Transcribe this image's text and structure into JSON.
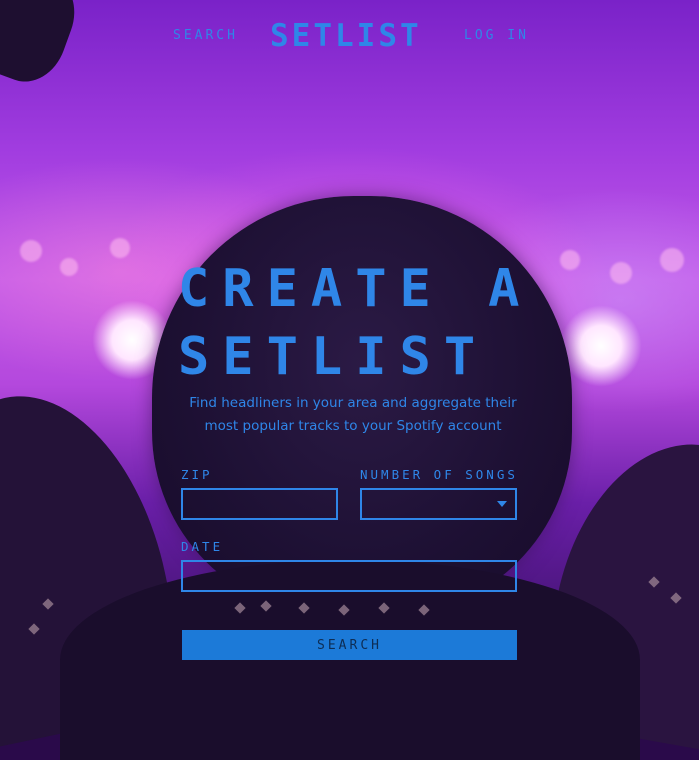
{
  "header": {
    "search_link": "SEARCH",
    "logo": "SETLIST",
    "login_link": "LOG IN"
  },
  "hero": {
    "title_line1": "CREATE A",
    "title_line2": "SETLIST",
    "subtitle": "Find headliners in your area and aggregate their most popular tracks to your Spotify account"
  },
  "form": {
    "zip_label": "ZIP",
    "zip_value": "",
    "songs_label": "NUMBER OF SONGS",
    "songs_selected": "",
    "date_label": "DATE",
    "date_value": "",
    "submit_label": "SEARCH"
  },
  "colors": {
    "accent": "#2f86e8",
    "button": "#1c7ad8",
    "background_top": "#7a22c8"
  },
  "icons": {
    "dropdown": "chevron-down-icon"
  }
}
